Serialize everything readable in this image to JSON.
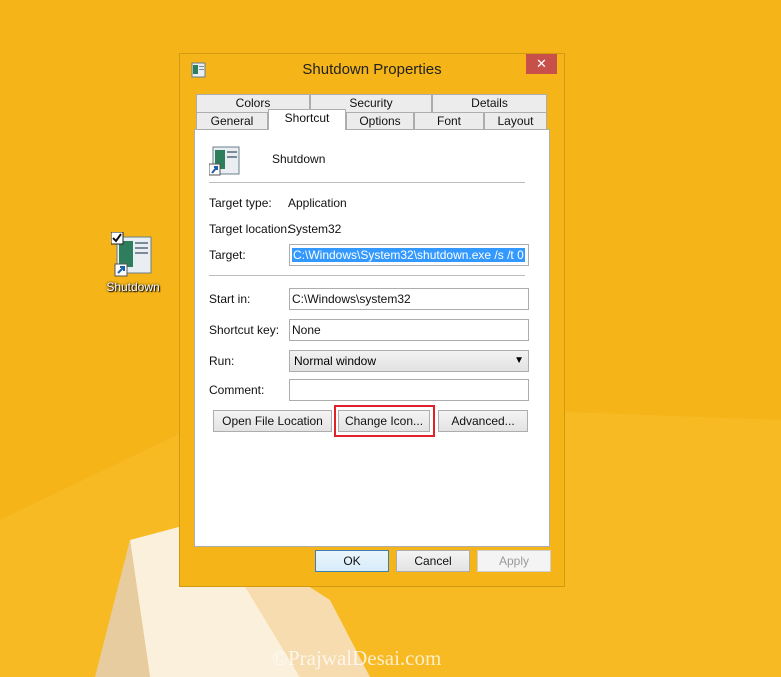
{
  "desktop": {
    "shortcut_label": "Shutdown"
  },
  "window": {
    "title": "Shutdown Properties",
    "close_glyph": "✕"
  },
  "tabs": {
    "row1": [
      "Colors",
      "Security",
      "Details"
    ],
    "row2": [
      "General",
      "Shortcut",
      "Options",
      "Font",
      "Layout"
    ],
    "active": "Shortcut"
  },
  "shortcut": {
    "name": "Shutdown",
    "target_type_label": "Target type:",
    "target_type_value": "Application",
    "target_location_label": "Target location:",
    "target_location_value": "System32",
    "target_label": "Target:",
    "target_value": "C:\\Windows\\System32\\shutdown.exe /s /t 0",
    "start_in_label": "Start in:",
    "start_in_value": "C:\\Windows\\system32",
    "shortcut_key_label": "Shortcut key:",
    "shortcut_key_value": "None",
    "run_label": "Run:",
    "run_value": "Normal window",
    "comment_label": "Comment:",
    "comment_value": ""
  },
  "buttons": {
    "open_file_location": "Open File Location",
    "change_icon": "Change Icon...",
    "advanced": "Advanced...",
    "ok": "OK",
    "cancel": "Cancel",
    "apply": "Apply"
  },
  "watermark": "©PrajwalDesai.com",
  "colors": {
    "desktop": "#f5b417",
    "close_button": "#c7504b",
    "highlight": "#e0212a",
    "selection": "#3399ff"
  }
}
